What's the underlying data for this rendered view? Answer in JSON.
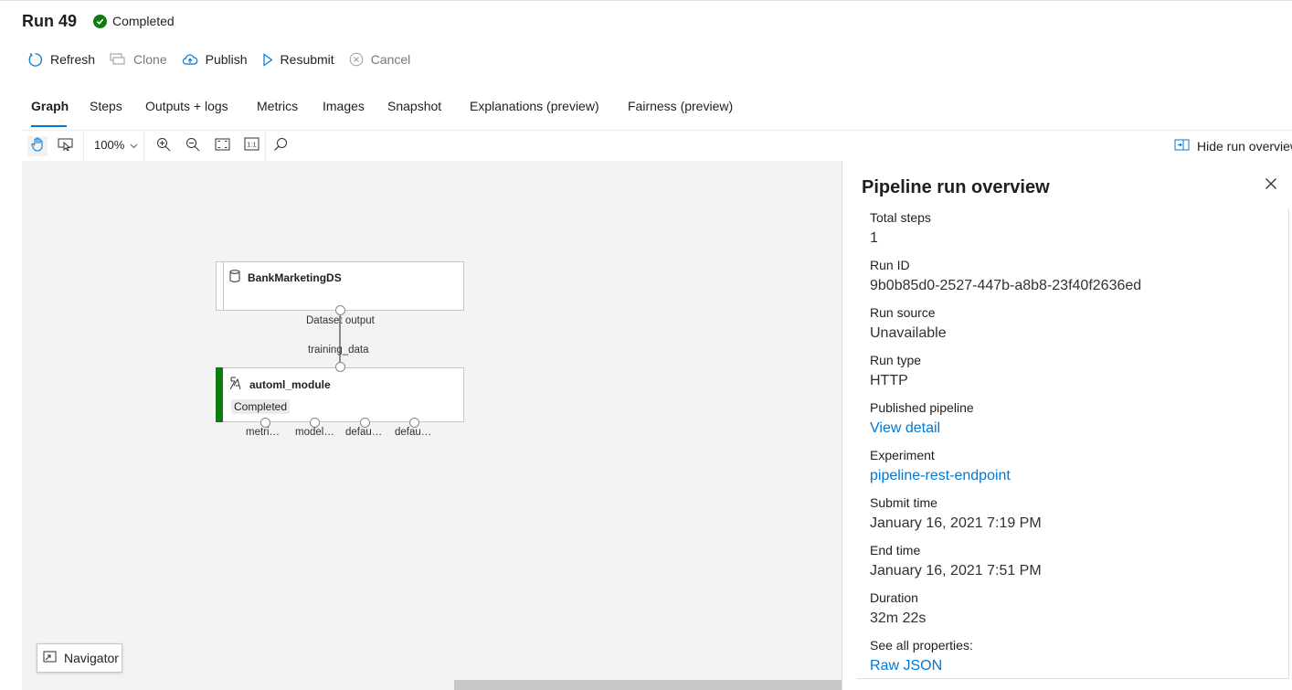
{
  "header": {
    "run_title": "Run 49",
    "status": "Completed",
    "status_color": "#107c10"
  },
  "toolbar": {
    "refresh": "Refresh",
    "clone": "Clone",
    "publish": "Publish",
    "resubmit": "Resubmit",
    "cancel": "Cancel"
  },
  "tabs": [
    "Graph",
    "Steps",
    "Outputs + logs",
    "Metrics",
    "Images",
    "Snapshot",
    "Explanations (preview)",
    "Fairness (preview)"
  ],
  "active_tab": "Graph",
  "canvas_toolbar": {
    "zoom": "100%",
    "hide_overview": "Hide run overview"
  },
  "graph": {
    "dataset_node": {
      "title": "BankMarketingDS",
      "output_port": "Dataset output"
    },
    "module_node": {
      "title": "automl_module",
      "status": "Completed",
      "input_port": "training_data",
      "output_ports": [
        "metri…",
        "model…",
        "defau…",
        "defau…"
      ]
    },
    "navigator": "Navigator"
  },
  "overview": {
    "title": "Pipeline run overview",
    "props": [
      {
        "label": "Total steps",
        "value": "1",
        "link": false
      },
      {
        "label": "Run ID",
        "value": "9b0b85d0-2527-447b-a8b8-23f40f2636ed",
        "link": false
      },
      {
        "label": "Run source",
        "value": "Unavailable",
        "link": false
      },
      {
        "label": "Run type",
        "value": "HTTP",
        "link": false
      },
      {
        "label": "Published pipeline",
        "value": "View detail",
        "link": true
      },
      {
        "label": "Experiment",
        "value": "pipeline-rest-endpoint",
        "link": true
      },
      {
        "label": "Submit time",
        "value": "January 16, 2021 7:19 PM",
        "link": false
      },
      {
        "label": "End time",
        "value": "January 16, 2021 7:51 PM",
        "link": false
      },
      {
        "label": "Duration",
        "value": "32m 22s",
        "link": false
      },
      {
        "label": "See all properties:",
        "value": "Raw JSON",
        "link": true
      }
    ]
  },
  "colors": {
    "accent": "#0078d4",
    "success": "#107c10"
  }
}
